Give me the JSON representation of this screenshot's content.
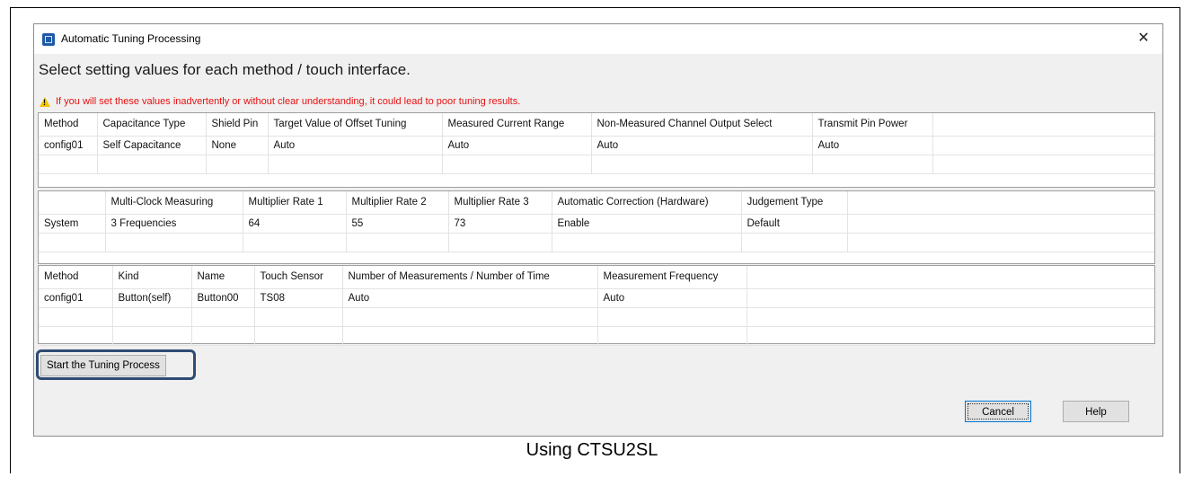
{
  "window": {
    "title": "Automatic Tuning Processing",
    "close_glyph": "✕"
  },
  "heading": "Select setting values for each method / touch interface.",
  "warning": "If you will set these values inadvertently or without clear understanding, it could lead to poor tuning results.",
  "method_table": {
    "headers": [
      "Method",
      "Capacitance Type",
      "Shield Pin",
      "Target Value of Offset Tuning",
      "Measured Current Range",
      "Non-Measured Channel Output Select",
      "Transmit Pin Power"
    ],
    "rows": [
      [
        "config01",
        "Self Capacitance",
        "None",
        "Auto",
        "Auto",
        "Auto",
        "Auto"
      ]
    ]
  },
  "system_table": {
    "headers": [
      "",
      "Multi-Clock Measuring",
      "Multiplier Rate 1",
      "Multiplier Rate 2",
      "Multiplier Rate 3",
      "Automatic Correction (Hardware)",
      "Judgement Type"
    ],
    "rows": [
      [
        "System",
        "3 Frequencies",
        "64",
        "55",
        "73",
        "Enable",
        "Default"
      ]
    ]
  },
  "touch_table": {
    "headers": [
      "Method",
      "Kind",
      "Name",
      "Touch Sensor",
      "Number of Measurements / Number of Time",
      "Measurement Frequency"
    ],
    "rows": [
      [
        "config01",
        "Button(self)",
        "Button00",
        "TS08",
        "Auto",
        "Auto"
      ]
    ]
  },
  "buttons": {
    "start": "Start the Tuning Process",
    "cancel": "Cancel",
    "help": "Help"
  },
  "caption": "Using CTSU2SL"
}
